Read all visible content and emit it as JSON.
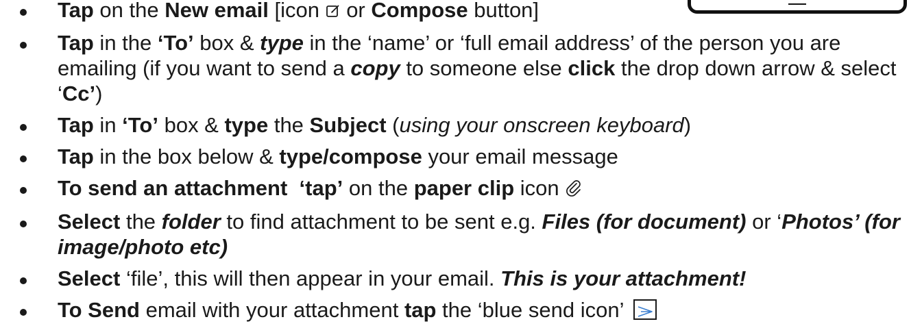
{
  "steps": [
    {
      "s1": "Tap",
      "s2": " on the ",
      "s3": "New email",
      "s4": " [icon ",
      "s5": " or ",
      "s6": "Compose",
      "s7": " button]",
      "icon": "compose-edit-icon"
    },
    {
      "s1": "Tap",
      "s2": " in the ",
      "s3": "‘To’",
      "s4": " box & ",
      "s5": "type",
      "s6": " in the ‘name’ or ‘full email address’ of the person you are emailing (if you want to send a ",
      "s7": "copy",
      "s8": " to someone else ",
      "s9": "click",
      "s10": " the drop down arrow & select ‘",
      "s11": "Cc’",
      "s12": ")"
    },
    {
      "s1": "Tap",
      "s2": " in ",
      "s3": "‘To’",
      "s4": " box & ",
      "s5": "type",
      "s6": " the ",
      "s7": "Subject",
      "s8": " (",
      "s9": "using your onscreen keyboard",
      "s10": ")"
    },
    {
      "s1": "Tap",
      "s2": " in the box below & ",
      "s3": "type/compose",
      "s4": " your email message"
    },
    {
      "s1": "To send an attachment",
      "s2": "  ",
      "s3": "‘tap’",
      "s4": " on the ",
      "s5": "paper clip",
      "s6": " icon ",
      "icon": "paperclip-icon"
    },
    {
      "s1": "Select",
      "s2": " the ",
      "s3": "folder",
      "s4": " to find attachment to be sent e.g. ",
      "s5": "Files (for document)",
      "s6": " or ‘",
      "s7": "Photos’ (for image/photo etc)"
    },
    {
      "s1": "Select",
      "s2": " ‘file’, this will then appear in your email. ",
      "s3": "This is your attachment!"
    },
    {
      "s1": "To Send",
      "s2": " email with your attachment ",
      "s3": "tap",
      "s4": " the ‘blue send icon’ ",
      "icon": "send-arrow-icon"
    }
  ]
}
